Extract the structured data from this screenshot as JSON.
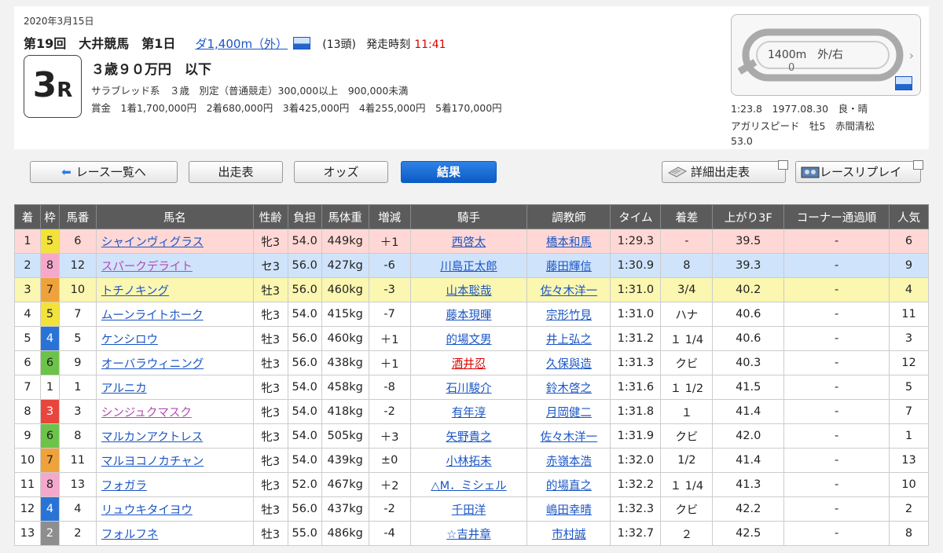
{
  "header": {
    "date": "2020年3月15日",
    "meeting": "第19回　大井競馬　第1日",
    "course": "ダ1,400m（外）",
    "heads": "(13頭)",
    "post_label": "発走時刻",
    "post_time": "11:41",
    "race_number": "3",
    "race_suffix": "R",
    "race_class": "３歳９０万円　以下",
    "conditions": "サラブレッド系　３歳　別定（普通競走）300,000以上　900,000未満",
    "prize": "賞金　1着1,700,000円　2着680,000円　3着425,000円　4着255,000円　5着170,000円"
  },
  "record": {
    "course_label": "1400m　外/右",
    "course_sub": "0",
    "time_line": "1:23.8　1977.08.30　良・晴",
    "horse_line": "アガリスピード　牡5　赤間清松",
    "weight_line": "53.0"
  },
  "nav": {
    "race_list": "レース一覧へ",
    "entries": "出走表",
    "odds": "オッズ",
    "results": "結果",
    "detail_entries": "詳細出走表",
    "replay": "レースリプレイ"
  },
  "table": {
    "headers": [
      "着",
      "枠",
      "馬番",
      "馬名",
      "性齢",
      "負担",
      "馬体重",
      "増減",
      "騎手",
      "調教師",
      "タイム",
      "着差",
      "上がり3F",
      "コーナー通過順",
      "人気"
    ],
    "rows": [
      {
        "pos": "1",
        "waku": "5",
        "num": "6",
        "horse": "シャインヴィグラス",
        "sex": "牝3",
        "wt": "54.0",
        "bw": "449kg",
        "diff": "＋1",
        "jockey": "西啓太",
        "trainer": "橋本和馬",
        "time": "1:29.3",
        "margin": "-",
        "f3": "39.5",
        "corner": "-",
        "pop": "6"
      },
      {
        "pos": "2",
        "waku": "8",
        "num": "12",
        "horse": "スパークデライト",
        "sex": "セ3",
        "wt": "56.0",
        "bw": "427kg",
        "diff": "-6",
        "jockey": "川島正太郎",
        "trainer": "藤田輝信",
        "time": "1:30.9",
        "margin": "8",
        "f3": "39.3",
        "corner": "-",
        "pop": "9"
      },
      {
        "pos": "3",
        "waku": "7",
        "num": "10",
        "horse": "トチノキング",
        "sex": "牡3",
        "wt": "56.0",
        "bw": "460kg",
        "diff": "-3",
        "jockey": "山本聡哉",
        "trainer": "佐々木洋一",
        "time": "1:31.0",
        "margin": "3/4",
        "f3": "40.2",
        "corner": "-",
        "pop": "4"
      },
      {
        "pos": "4",
        "waku": "5",
        "num": "7",
        "horse": "ムーンライトホーク",
        "sex": "牝3",
        "wt": "54.0",
        "bw": "415kg",
        "diff": "-7",
        "jockey": "藤本現暉",
        "trainer": "宗形竹見",
        "time": "1:31.0",
        "margin": "ハナ",
        "f3": "40.6",
        "corner": "-",
        "pop": "11"
      },
      {
        "pos": "5",
        "waku": "4",
        "num": "5",
        "horse": "ケンシロウ",
        "sex": "牡3",
        "wt": "56.0",
        "bw": "460kg",
        "diff": "＋1",
        "jockey": "的場文男",
        "trainer": "井上弘之",
        "time": "1:31.2",
        "margin": "１ 1/4",
        "f3": "40.6",
        "corner": "-",
        "pop": "3"
      },
      {
        "pos": "6",
        "waku": "6",
        "num": "9",
        "horse": "オーバラウィニング",
        "sex": "牡3",
        "wt": "56.0",
        "bw": "438kg",
        "diff": "＋1",
        "jockey": "酒井忍",
        "trainer": "久保與造",
        "time": "1:31.3",
        "margin": "クビ",
        "f3": "40.3",
        "corner": "-",
        "pop": "12"
      },
      {
        "pos": "7",
        "waku": "1",
        "num": "1",
        "horse": "アルニカ",
        "sex": "牝3",
        "wt": "54.0",
        "bw": "458kg",
        "diff": "-8",
        "jockey": "石川駿介",
        "trainer": "鈴木啓之",
        "time": "1:31.6",
        "margin": "１ 1/2",
        "f3": "41.5",
        "corner": "-",
        "pop": "5"
      },
      {
        "pos": "8",
        "waku": "3",
        "num": "3",
        "horse": "シンジュクマスク",
        "sex": "牝3",
        "wt": "54.0",
        "bw": "418kg",
        "diff": "-2",
        "jockey": "有年淳",
        "trainer": "月岡健二",
        "time": "1:31.8",
        "margin": "１",
        "f3": "41.4",
        "corner": "-",
        "pop": "7"
      },
      {
        "pos": "9",
        "waku": "6",
        "num": "8",
        "horse": "マルカンアクトレス",
        "sex": "牝3",
        "wt": "54.0",
        "bw": "505kg",
        "diff": "＋3",
        "jockey": "矢野貴之",
        "trainer": "佐々木洋一",
        "time": "1:31.9",
        "margin": "クビ",
        "f3": "42.0",
        "corner": "-",
        "pop": "1"
      },
      {
        "pos": "10",
        "waku": "7",
        "num": "11",
        "horse": "マルヨコノカチャン",
        "sex": "牝3",
        "wt": "54.0",
        "bw": "439kg",
        "diff": "±0",
        "jockey": "小林拓未",
        "trainer": "赤嶺本浩",
        "time": "1:32.0",
        "margin": "1/2",
        "f3": "41.4",
        "corner": "-",
        "pop": "13"
      },
      {
        "pos": "11",
        "waku": "8",
        "num": "13",
        "horse": "フォガラ",
        "sex": "牝3",
        "wt": "52.0",
        "bw": "467kg",
        "diff": "＋2",
        "jockey": "△M．ミシェル",
        "trainer": "的場直之",
        "time": "1:32.2",
        "margin": "１ 1/4",
        "f3": "41.3",
        "corner": "-",
        "pop": "10"
      },
      {
        "pos": "12",
        "waku": "4",
        "num": "4",
        "horse": "リュウキタイヨウ",
        "sex": "牡3",
        "wt": "56.0",
        "bw": "437kg",
        "diff": "-2",
        "jockey": "千田洋",
        "trainer": "嶋田幸晴",
        "time": "1:32.3",
        "margin": "クビ",
        "f3": "42.2",
        "corner": "-",
        "pop": "2"
      },
      {
        "pos": "13",
        "waku": "2",
        "num": "2",
        "horse": "フォルフネ",
        "sex": "牡3",
        "wt": "55.0",
        "bw": "486kg",
        "diff": "-4",
        "jockey": "☆吉井章",
        "trainer": "市村誠",
        "time": "1:32.7",
        "margin": "２",
        "f3": "42.5",
        "corner": "-",
        "pop": "8"
      }
    ]
  },
  "colors": {
    "link": "#1a55c4",
    "filly_link": "#b24cb0",
    "first_row": "#ffd8d6",
    "second_row": "#cfe3fb",
    "third_row": "#fbf6b0",
    "post_time": "#dd0000"
  }
}
